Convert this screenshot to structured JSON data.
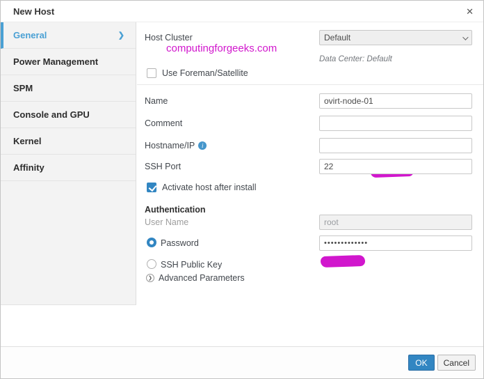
{
  "colors": {
    "accent": "#3286c2",
    "accent-light": "#4aa0d4",
    "magenta": "#d117cd",
    "sidebar-bg": "#f3f3f3"
  },
  "dialog": {
    "title": "New Host",
    "close_glyph": "✕"
  },
  "sidebar": {
    "items": [
      {
        "label": "General",
        "active": true,
        "chevron": "❯"
      },
      {
        "label": "Power Management"
      },
      {
        "label": "SPM"
      },
      {
        "label": "Console and GPU"
      },
      {
        "label": "Kernel"
      },
      {
        "label": "Affinity"
      }
    ]
  },
  "watermark": "computingforgeeks.com",
  "form": {
    "host_cluster_label": "Host Cluster",
    "host_cluster_value": "Default",
    "data_center_note": "Data Center: Default",
    "foreman_label": "Use Foreman/Satellite",
    "name_label": "Name",
    "name_value": "ovirt-node-01",
    "comment_label": "Comment",
    "comment_value": "",
    "hostname_label": "Hostname/IP",
    "info_glyph": "i",
    "hostname_value": "",
    "ssh_port_label": "SSH Port",
    "ssh_port_value": "22",
    "activate_label": "Activate host after install",
    "auth_header": "Authentication",
    "username_label": "User Name",
    "username_value": "root",
    "password_label": "Password",
    "password_value": "•••••••••••••",
    "ssh_key_label": "SSH Public Key",
    "advanced_glyph": "❯",
    "advanced_label": "Advanced Parameters"
  },
  "footer": {
    "ok_label": "OK",
    "cancel_label": "Cancel"
  }
}
